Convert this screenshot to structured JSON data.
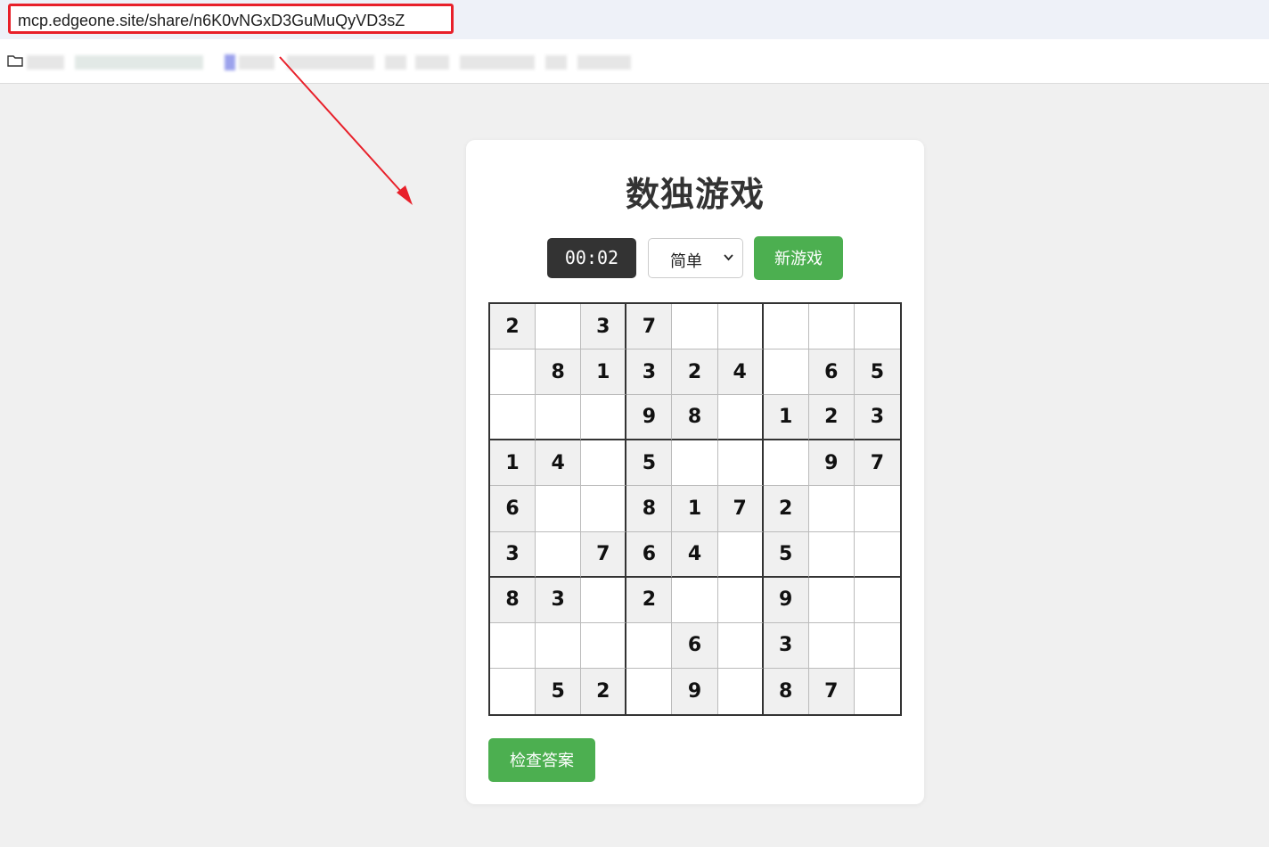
{
  "browser": {
    "url": "mcp.edgeone.site/share/n6K0vNGxD3GuMuQyVD3sZ"
  },
  "game": {
    "title": "数独游戏",
    "timer": "00:02",
    "difficulty": {
      "selected": "简单"
    },
    "new_game_label": "新游戏",
    "check_label": "检查答案",
    "board": [
      [
        "2",
        "",
        "3",
        "7",
        "",
        "",
        "",
        "",
        ""
      ],
      [
        "",
        "8",
        "1",
        "3",
        "2",
        "4",
        "",
        "6",
        "5"
      ],
      [
        "",
        "",
        "",
        "9",
        "8",
        "",
        "1",
        "2",
        "3"
      ],
      [
        "1",
        "4",
        "",
        "5",
        "",
        "",
        "",
        "9",
        "7"
      ],
      [
        "6",
        "",
        "",
        "8",
        "1",
        "7",
        "2",
        "",
        ""
      ],
      [
        "3",
        "",
        "7",
        "6",
        "4",
        "",
        "5",
        "",
        ""
      ],
      [
        "8",
        "3",
        "",
        "2",
        "",
        "",
        "9",
        "",
        ""
      ],
      [
        "",
        "",
        "",
        "",
        "6",
        "",
        "3",
        "",
        ""
      ],
      [
        "",
        "5",
        "2",
        "",
        "9",
        "",
        "8",
        "7",
        ""
      ]
    ]
  },
  "colors": {
    "accent_green": "#4caf50",
    "timer_bg": "#333333",
    "annotation_red": "#e8202a",
    "page_bg": "#f0f0f0"
  },
  "icons": {
    "bookmark_folder": "folder-icon",
    "select_dropdown": "chevron-down-icon"
  }
}
